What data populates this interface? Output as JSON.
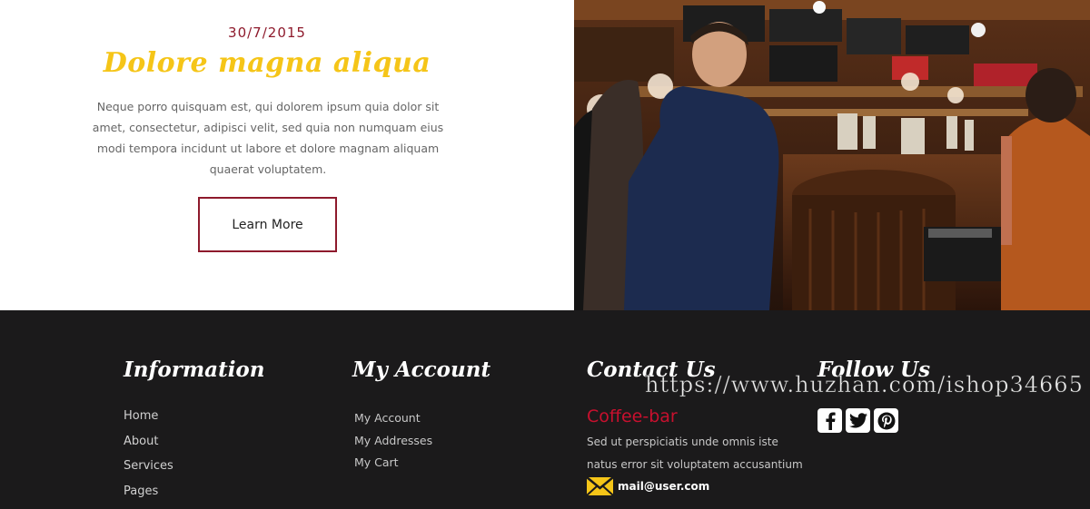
{
  "promo": {
    "date": "30/7/2015",
    "headline": "Dolore magna aliqua",
    "body": "Neque porro quisquam est, qui dolorem ipsum quia dolor sit amet, consectetur, adipisci velit, sed quia non numquam eius modi tempora incidunt ut labore et dolore magnam aliquam quaerat voluptatem.",
    "button_label": "Learn More",
    "accent_color": "#8e1a2c",
    "headline_color": "#f5c518"
  },
  "footer": {
    "background": "#1b1a1b",
    "information": {
      "title": "Information",
      "links": [
        "Home",
        "About",
        "Services",
        "Pages"
      ]
    },
    "account": {
      "title": "My Account",
      "links": [
        "My Account",
        "My Addresses",
        "My Cart"
      ]
    },
    "contact": {
      "title": "Contact Us",
      "brand": "Coffee-bar",
      "text": "Sed ut perspiciatis unde omnis iste natus error sit voluptatem accusantium",
      "email": "mail@user.com",
      "icon": "mail-icon"
    },
    "follow": {
      "title": "Follow Us",
      "icons": [
        "facebook-icon",
        "twitter-icon",
        "pinterest-icon"
      ]
    }
  },
  "watermark": "https://www.huzhan.com/ishop34665"
}
